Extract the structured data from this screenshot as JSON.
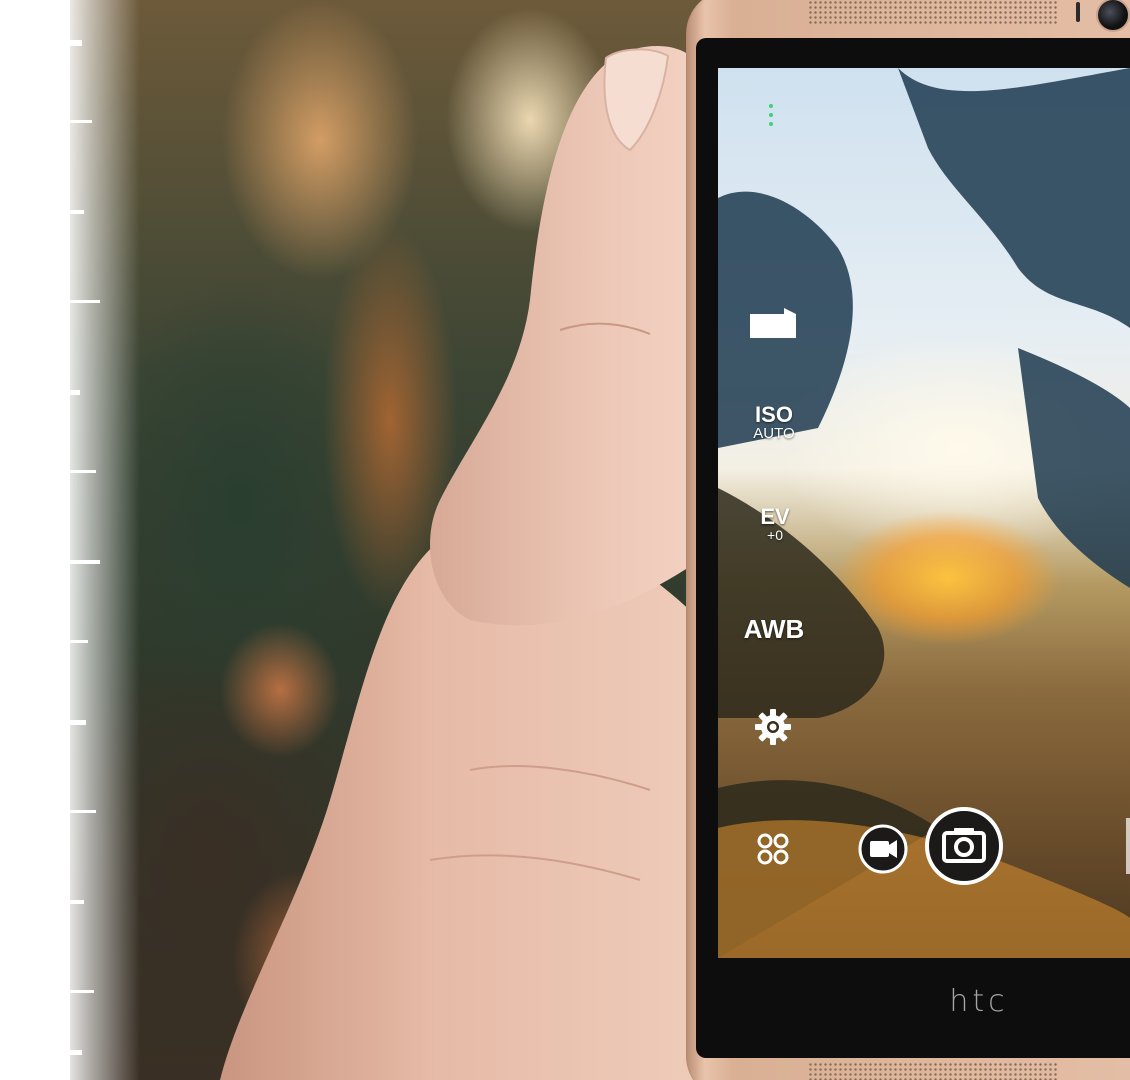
{
  "scene": {
    "brand_logo_text": "htc"
  },
  "camera_ui": {
    "iso": {
      "label": "ISO",
      "value": "AUTO"
    },
    "ev": {
      "label": "EV",
      "value": "+0"
    },
    "awb": {
      "label": "AWB"
    },
    "icons": [
      "menu-dots-icon",
      "capture-mode-icon",
      "gear-icon",
      "modes-grid-icon",
      "video-camera-icon",
      "camera-shutter-icon"
    ]
  },
  "colors": {
    "phone_body": "#e4bea6",
    "skin": "#e3b6a2",
    "indicator_green": "#3fd07a",
    "ui_white": "#ffffff"
  }
}
